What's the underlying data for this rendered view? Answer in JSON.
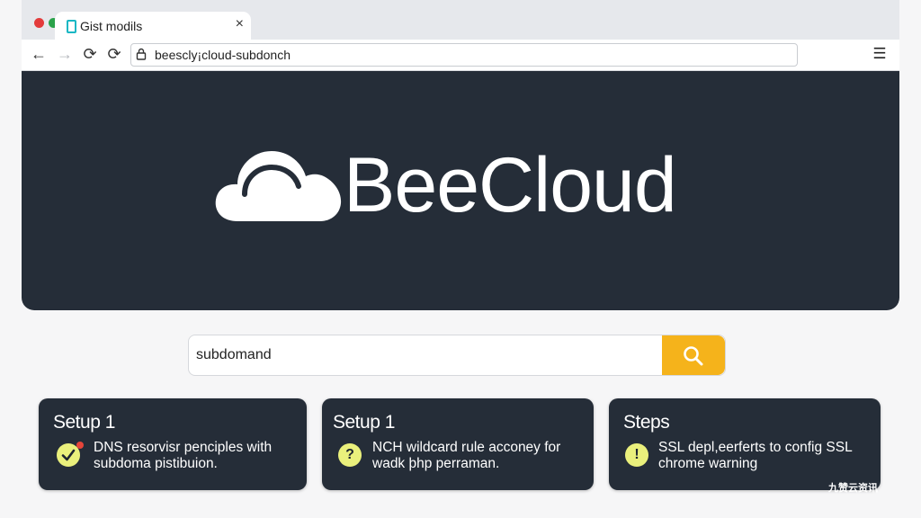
{
  "browser": {
    "tab_title": "Gist modils",
    "tab_close": "×",
    "url": "beescly¡cloud-subdonch",
    "nav": {
      "back": "←",
      "forward": "→",
      "reload": "⟳",
      "reload2": "⟳"
    },
    "menu": "☰"
  },
  "hero": {
    "brand": "BeeCloud",
    "logo_icon": "cloud-icon"
  },
  "search": {
    "value": "subdomand",
    "button_icon": "search-icon",
    "accent": "#f5b31b"
  },
  "cards": [
    {
      "title": "Setup 1",
      "icon": "check-icon",
      "text_line1": "DNS resorvisr penciples with",
      "text_line2": "subdoma pistibuion."
    },
    {
      "title": "Setup 1",
      "icon": "question-icon",
      "icon_glyph": "?",
      "text_line1": "NCH wildcard rule acconey for",
      "text_line2": "wadk þhp perraman."
    },
    {
      "title": "Steps",
      "icon": "info-icon",
      "icon_glyph": "!",
      "text_line1": "SSL depl,eerferts to config SSL",
      "text_line2": "chrome warning"
    }
  ],
  "watermark": "九赞云资讯",
  "colors": {
    "hero_bg": "#252d38",
    "card_bg": "#252d38",
    "icon_bg": "#eaf07c",
    "page_bg": "#f6f6f7"
  }
}
